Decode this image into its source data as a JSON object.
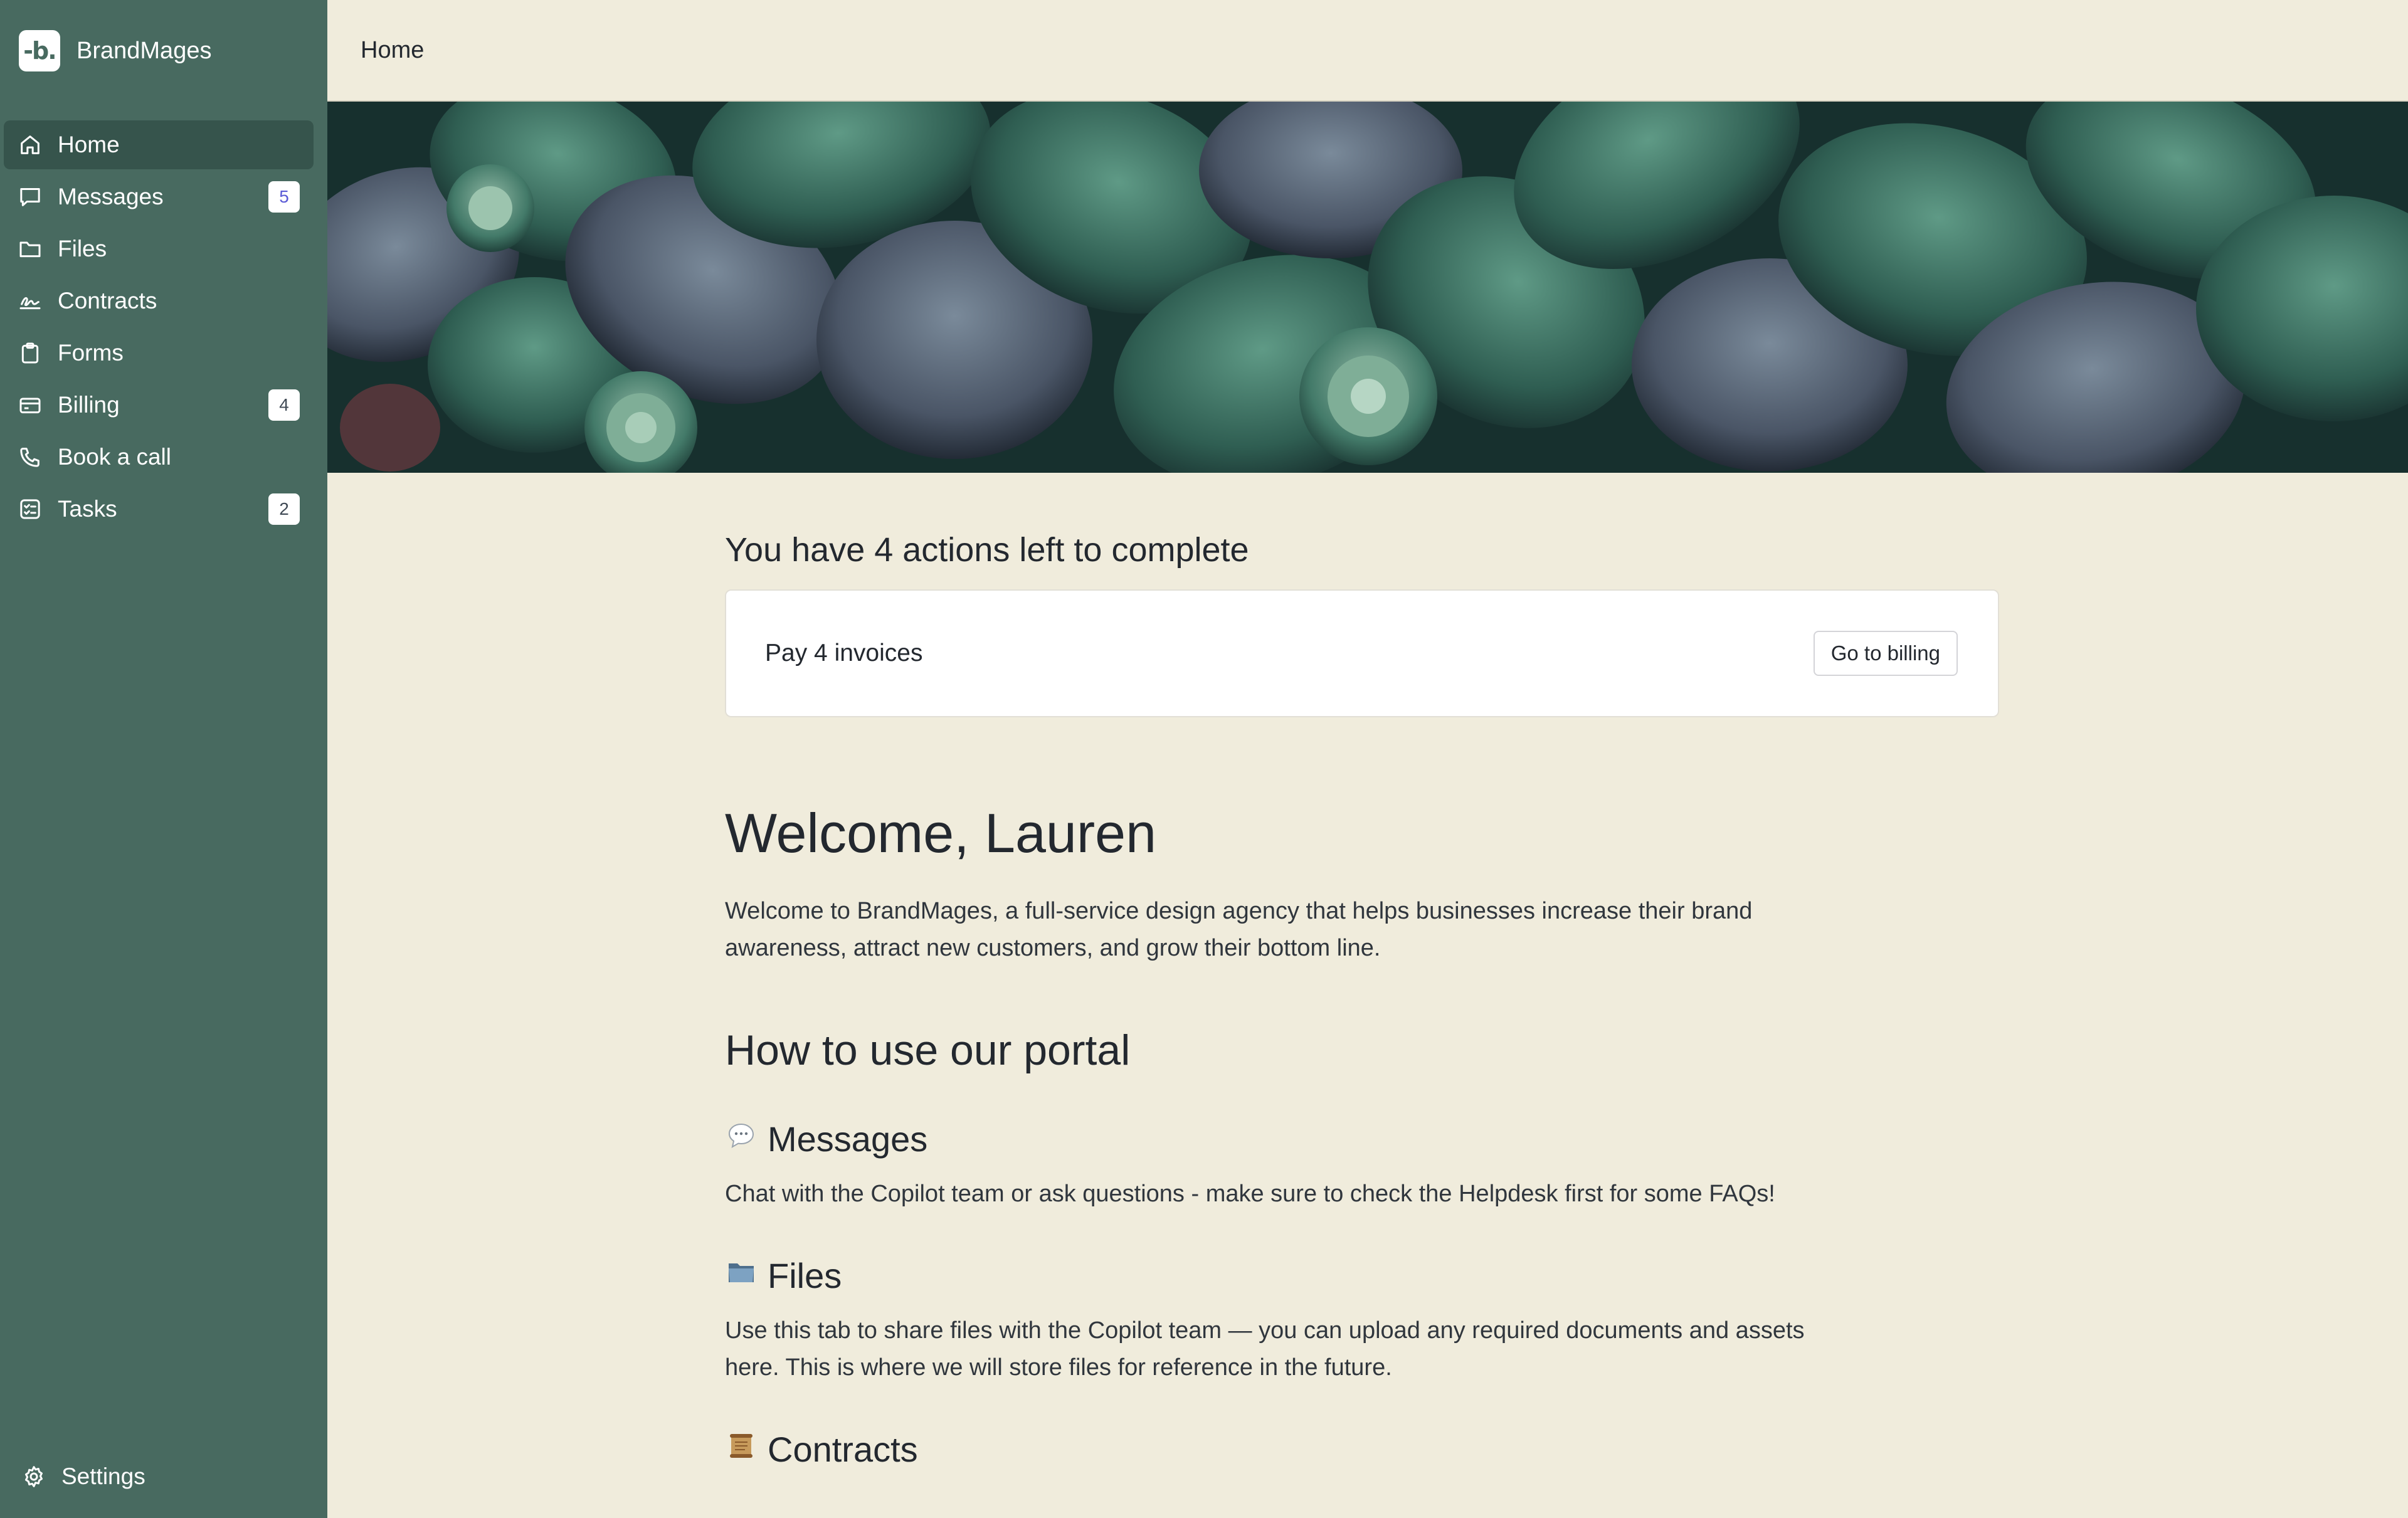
{
  "brand": {
    "logo_text": "-b.",
    "name": "BrandMages"
  },
  "nav": {
    "items": [
      {
        "label": "Home",
        "icon": "home-icon",
        "active": true
      },
      {
        "label": "Messages",
        "icon": "message-icon",
        "badge": "5"
      },
      {
        "label": "Files",
        "icon": "folder-icon"
      },
      {
        "label": "Contracts",
        "icon": "signature-icon"
      },
      {
        "label": "Forms",
        "icon": "clipboard-icon"
      },
      {
        "label": "Billing",
        "icon": "credit-card-icon",
        "badge": "4"
      },
      {
        "label": "Book a call",
        "icon": "phone-icon"
      },
      {
        "label": "Tasks",
        "icon": "checklist-icon",
        "badge": "2"
      }
    ],
    "settings": {
      "label": "Settings",
      "icon": "gear-icon"
    }
  },
  "header": {
    "title": "Home"
  },
  "banner": {
    "image": "succulent-plants-photo"
  },
  "actions": {
    "title": "You have 4 actions left to complete",
    "card_text": "Pay 4 invoices",
    "button_label": "Go to billing"
  },
  "welcome": {
    "title": "Welcome, Lauren",
    "text": "Welcome to BrandMages, a full-service design agency that helps businesses increase their brand awareness, attract new customers, and grow their bottom line."
  },
  "portal": {
    "title": "How to use our portal",
    "sections": [
      {
        "emoji": "speech-balloon",
        "title": "Messages",
        "text": "Chat with the Copilot team or ask questions - make sure to check the Helpdesk first for some FAQs!"
      },
      {
        "emoji": "file-folder",
        "title": "Files",
        "text": "Use this tab to share files with the Copilot team — you can upload any required documents and assets here. This is where we will store files for reference in the future."
      },
      {
        "emoji": "scroll",
        "title": "Contracts"
      }
    ]
  },
  "colors": {
    "sidebar": "#486a60",
    "sidebar_active": "#36544c",
    "background": "#f0ecdc",
    "text": "#23282f"
  }
}
